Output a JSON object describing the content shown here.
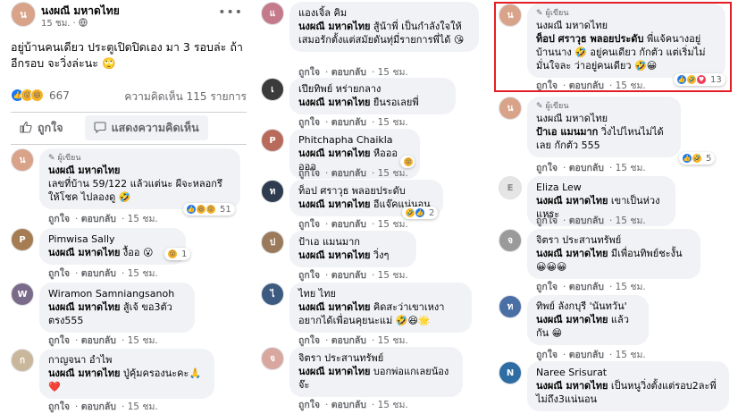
{
  "post": {
    "author": "นงผณี มหาดไทย",
    "time": "15 ชม.",
    "globe_icon": "globe-icon",
    "text": "อยู่บ้านคนเดียว ประตูเปิดปิดเอง มา 3 รอบล่ะ ถ้าอีกรอบ จะวิ่งล่ะนะ 🙄",
    "reaction_count": "667",
    "comment_count": "ความคิดเห็น 115 รายการ",
    "like_label": "ถูกใจ",
    "comment_label": "แสดงความคิดเห็น"
  },
  "common": {
    "like": "ถูกใจ",
    "reply": "ตอบกลับ",
    "time": "15 ชม.",
    "author_badge": "ผู้เขียน",
    "tag": "นงผณี มหาดไทย"
  },
  "column1": [
    {
      "name": "นงผณี มหาดไทย",
      "author": true,
      "text": "เลขที่บ้าน 59/122 แล้วแต่นะ ผีจะหลอกรึให้โชค ไปลองดู 🤣",
      "react_count": "51"
    },
    {
      "name": "Pimwisa Sally",
      "text": "งื้ออ 😮",
      "react_count": "1"
    },
    {
      "name": "Wiramon Samniangsanoh",
      "text": "สู้เจ้ ขอ3ตัวตรง555",
      "react_count": ""
    },
    {
      "name": "กาญจนา อำไพ",
      "text": "ปู่คุ้มครองนะคะ🙏 ❤️",
      "react_count": ""
    }
  ],
  "column2": [
    {
      "name": "แองเจิ้ล คิม",
      "text": "สู้น้าพี่ เป็นกำลังใจให้เสมอรักตั้งแต่สมัยดันทุ่มี่รายการพี่ได้ 😘",
      "react_count": ""
    },
    {
      "name": "เปียทิพย์ หร่ายกลาง",
      "text": "ยืนรอเลยพี่",
      "react_count": ""
    },
    {
      "name": "Phitchapha Chaikla",
      "text": "หืออออออ",
      "react_count": ""
    },
    {
      "name": "ท็อป ศราวุธ พลอยประดับ",
      "text": "อีแจ๊คแน่นอน",
      "react_count": "2"
    },
    {
      "name": "ป้าเอ แมนมาก",
      "text": "วิ่งๆ",
      "react_count": ""
    },
    {
      "name": "ไทย ไทย",
      "text": "คิดสะว่าเขาเหงาอยากได้เพื่อนคุยนะแม่ 🤣😆🌟",
      "react_count": ""
    },
    {
      "name": "จิตรา ประสานทรัพย์",
      "text": "บอกพ่อแกเลยน้องจ๊ะ",
      "react_count": ""
    }
  ],
  "column3": [
    {
      "name": "นงผณี มหาดไทย",
      "author": true,
      "mention": "ท็อป ศราวุธ พลอยประดับ",
      "text": "พี่แจ้คนางอยู่บ้านนาง 🤣 อยู่คนเดียว กักตัว แต่เริ่มไม่มั่นใจละ ว่าอยู่คนเดียว 🤣😀",
      "react_count": "13"
    },
    {
      "name": "นงผณี มหาดไทย",
      "author": true,
      "mention": "ป้าเอ แมนมาก",
      "text": "วิ่งไปไหนไม่ได้เลย กักตัว 555",
      "react_count": "5"
    },
    {
      "name": "Eliza Lew",
      "text": "เขาเป็นห่วงแหระ",
      "react_count": ""
    },
    {
      "name": "จิตรา ประสานทรัพย์",
      "text": "มีเพื่อนทิพย์ชะงั้น 😀😀😀",
      "react_count": ""
    },
    {
      "name": "ทิพย์ ลังกบุรี 'นันทวัน'",
      "text": "แล้วกัน 😁",
      "react_count": ""
    },
    {
      "name": "Naree Srisurat",
      "text": "เป็นหนูวิ่งตั้งแต่รอบ2ละพี่ไม่ถึง3แน่นอน",
      "react_count": ""
    }
  ],
  "colors": {
    "facebook_blue": "#1877f2",
    "highlight_red": "#e41e26",
    "bubble_gray": "#f0f2f5",
    "meta_gray": "#65676b"
  }
}
